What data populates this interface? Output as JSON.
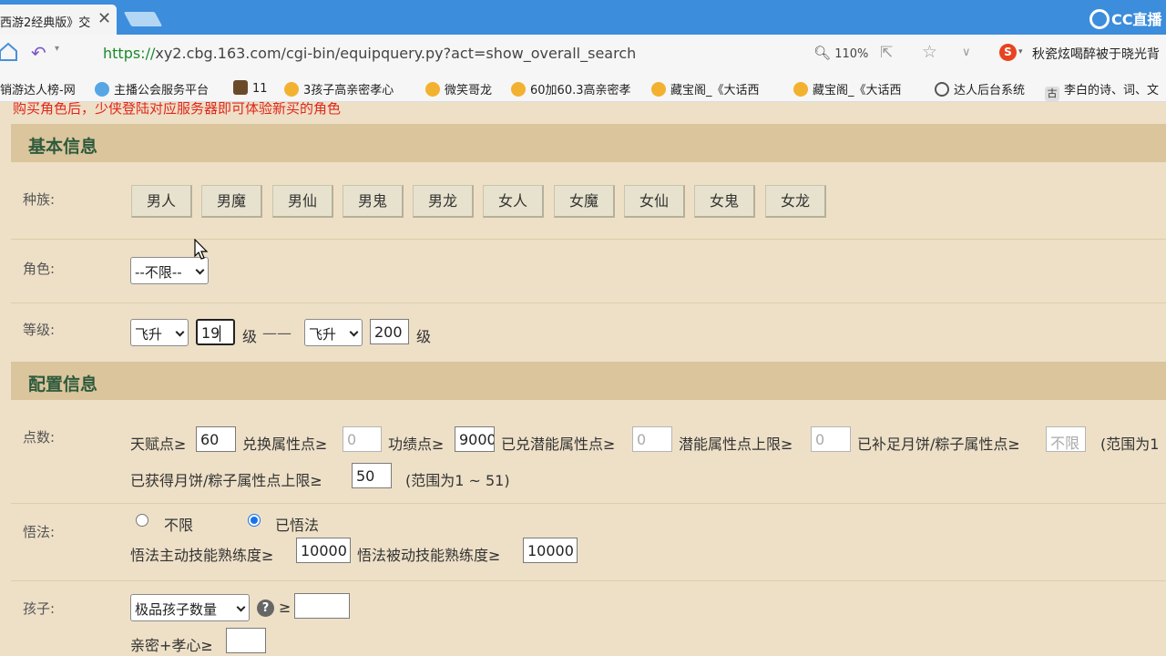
{
  "browser": {
    "tab_title": "西游2经典版》交",
    "tab_close": "✕",
    "cc_logo": "CC直播",
    "url_scheme": "https://",
    "url_rest": "xy2.cbg.163.com/cgi-bin/equipquery.py?act=show_overall_search",
    "zoom": "110%",
    "search_text": "秋瓷炫喝醉被于晓光背",
    "search_engine_letter": "S",
    "bookmarks": [
      {
        "label": "销游达人榜-网",
        "icon": "none"
      },
      {
        "label": "主播公会服务平台",
        "icon": "blue"
      },
      {
        "label": "11",
        "icon": "brown"
      },
      {
        "label": "3孩子高亲密孝心",
        "icon": "gold"
      },
      {
        "label": "微笑哥龙",
        "icon": "gold"
      },
      {
        "label": "60加60.3高亲密孝",
        "icon": "gold"
      },
      {
        "label": "藏宝阁_《大话西",
        "icon": "gold"
      },
      {
        "label": "藏宝阁_《大话西",
        "icon": "gold"
      },
      {
        "label": "达人后台系统",
        "icon": "globe"
      },
      {
        "label": "李白的诗、词、文",
        "icon": "gu"
      }
    ],
    "bookmark_gu": "古"
  },
  "page": {
    "notice": "购买角色后，少侠登陆对应服务器即可体验新买的角色",
    "basic_section": "基本信息",
    "config_section": "配置信息",
    "race": {
      "label": "种族:",
      "options": [
        "男人",
        "男魔",
        "男仙",
        "男鬼",
        "男龙",
        "女人",
        "女魔",
        "女仙",
        "女鬼",
        "女龙"
      ]
    },
    "role": {
      "label": "角色:",
      "value": "--不限--"
    },
    "level": {
      "label": "等级:",
      "from_select": "飞升",
      "from_value": "19",
      "unit": "级",
      "dash": "——",
      "to_select": "飞升",
      "to_value": "200",
      "unit2": "级"
    },
    "points": {
      "label": "点数:",
      "talent_label": "天赋点≥",
      "talent_value": "60",
      "exchange_label": "兑换属性点≥",
      "exchange_placeholder": "0",
      "merit_label": "功绩点≥",
      "merit_value": "9000",
      "potential_label": "已兑潜能属性点≥",
      "potential_placeholder": "0",
      "potential_cap_label": "潜能属性点上限≥",
      "potential_cap_placeholder": "0",
      "mooncake_label": "已补足月饼/粽子属性点≥",
      "mooncake_placeholder": "不限",
      "mooncake_range": "(范围为1",
      "mooncake_cap_label": "已获得月饼/粽子属性点上限≥",
      "mooncake_cap_value": "50",
      "mooncake_cap_range": "(范围为1 ~ 51)"
    },
    "wufa": {
      "label": "悟法:",
      "opt_none": "不限",
      "opt_done": "已悟法",
      "active_label": "悟法主动技能熟练度≥",
      "active_value": "10000",
      "passive_label": "悟法被动技能熟练度≥",
      "passive_value": "10000"
    },
    "child": {
      "label": "孩子:",
      "select": "极品孩子数量",
      "help": "?",
      "ge": "≥",
      "value": "",
      "intimacy_label": "亲密+孝心≥",
      "intimacy_value": ""
    }
  }
}
